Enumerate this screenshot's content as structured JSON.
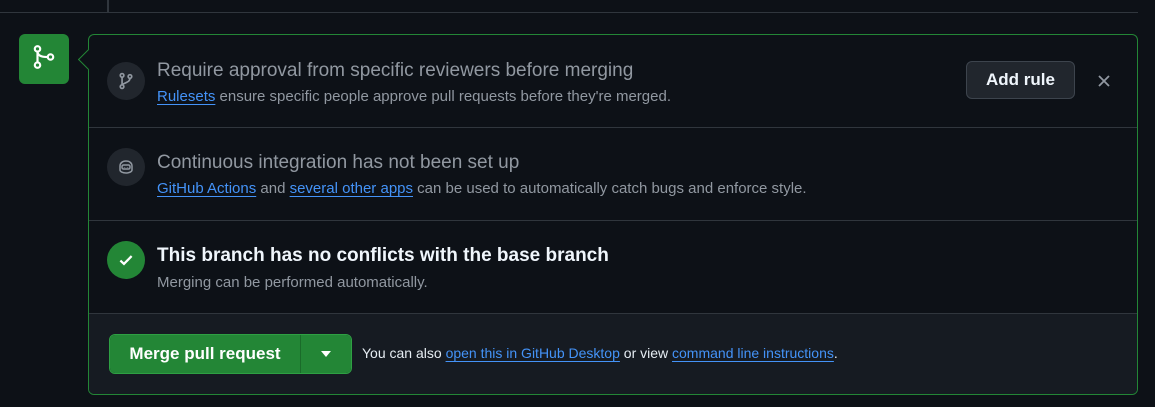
{
  "colors": {
    "background": "#0d1117",
    "accent_green": "#238636",
    "link_blue": "#4493f8",
    "muted_text": "#9198a1",
    "border": "#30363d"
  },
  "merge_badge": {
    "icon": "git-merge-icon"
  },
  "rules_section": {
    "icon": "git-branch-icon",
    "title": "Require approval from specific reviewers before merging",
    "desc_link": "Rulesets",
    "desc_rest": " ensure specific people approve pull requests before they're merged.",
    "add_rule_label": "Add rule",
    "dismiss_icon": "close-icon"
  },
  "ci_section": {
    "icon": "copilot-icon",
    "title": "Continuous integration has not been set up",
    "link1": "GitHub Actions",
    "text_and": " and ",
    "link2": "several other apps",
    "text_rest": " can be used to automatically catch bugs and enforce style."
  },
  "conflicts_section": {
    "icon": "check-icon",
    "title": "This branch has no conflicts with the base branch",
    "desc": "Merging can be performed automatically."
  },
  "merge_footer": {
    "merge_label": "Merge pull request",
    "caret_icon": "triangle-down-icon",
    "text_prefix": "You can also ",
    "link_desktop": "open this in GitHub Desktop",
    "text_mid": " or view ",
    "link_cli": "command line instructions",
    "text_suffix": "."
  }
}
